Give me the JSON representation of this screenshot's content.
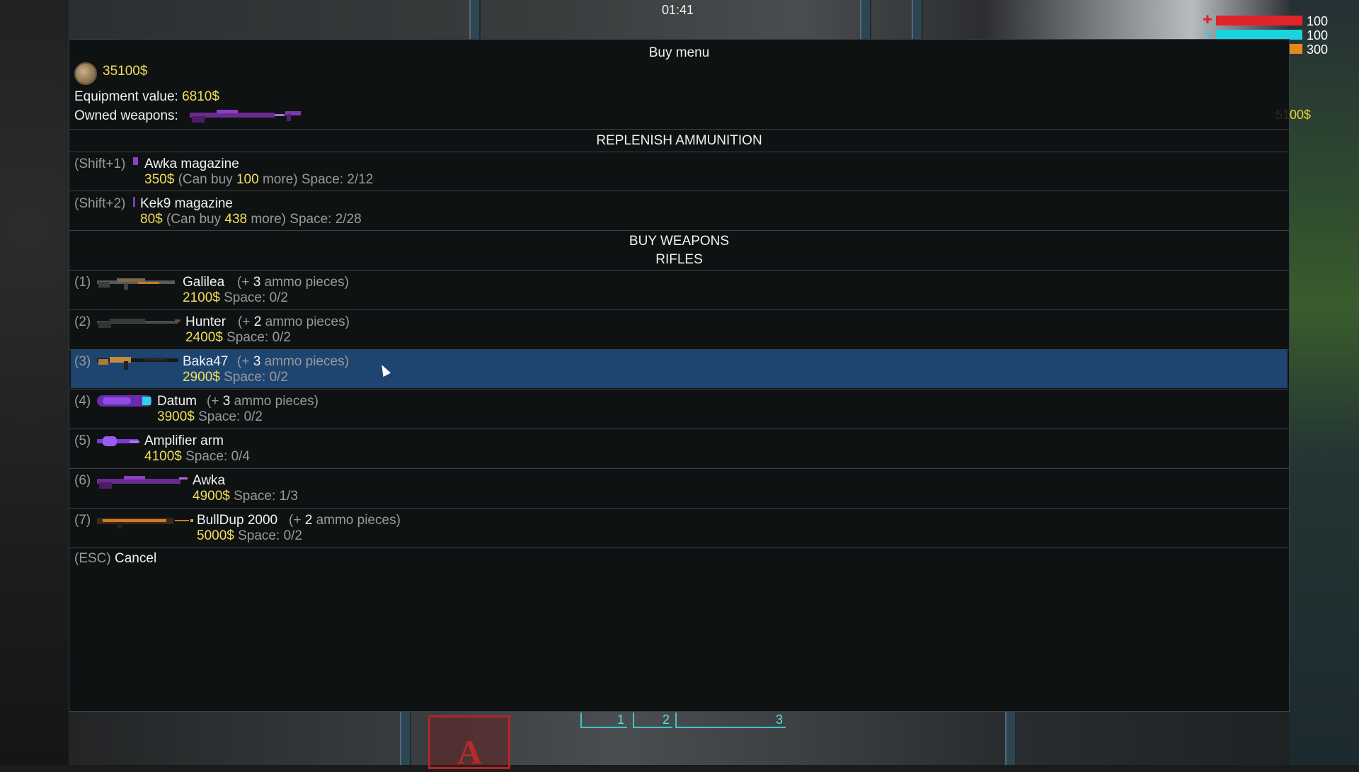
{
  "hud": {
    "clock": "01:41",
    "health": {
      "value": "100",
      "fraction": 1.0,
      "color": "#e0242a",
      "icon": "health-cross-icon"
    },
    "shield": {
      "value": "100",
      "fraction": 1.0,
      "color": "#19d4df",
      "icon": "energy-bolt-icon"
    },
    "ammo": {
      "value": "300",
      "fraction": 1.0,
      "color": "#e28a1c",
      "icon": "ammo-icon"
    },
    "money_partial": "5100$",
    "slots": [
      "1",
      "2",
      "3"
    ]
  },
  "menu": {
    "title": "Buy menu",
    "cash": "35100$",
    "equipment_value_label": "Equipment value:",
    "equipment_value": "6810$",
    "owned_weapons_label": "Owned weapons:",
    "replenish_title": "REPLENISH AMMUNITION",
    "buy_weapons_title": "BUY WEAPONS",
    "category_title": "RIFLES",
    "ammo": [
      {
        "key": "(Shift+1)",
        "name": "Awka magazine",
        "price": "350$",
        "can_buy_prefix": "(Can buy",
        "can_buy": "100",
        "can_buy_suffix": "more)",
        "space_label": "Space:",
        "space": "2/12",
        "icon": "awka-magazine-icon"
      },
      {
        "key": "(Shift+2)",
        "name": "Kek9 magazine",
        "price": "80$",
        "can_buy_prefix": "(Can buy",
        "can_buy": "438",
        "can_buy_suffix": "more)",
        "space_label": "Space:",
        "space": "2/28",
        "icon": "kek9-magazine-icon"
      }
    ],
    "weapons": [
      {
        "key": "(1)",
        "name": "Galilea",
        "ammo_prefix": "(+",
        "ammo_count": "3",
        "ammo_suffix": "ammo pieces)",
        "price": "2100$",
        "space_label": "Space:",
        "space": "0/2",
        "icon": "galilea-rifle-icon",
        "selected": false
      },
      {
        "key": "(2)",
        "name": "Hunter",
        "ammo_prefix": "(+",
        "ammo_count": "2",
        "ammo_suffix": "ammo pieces)",
        "price": "2400$",
        "space_label": "Space:",
        "space": "0/2",
        "icon": "hunter-rifle-icon",
        "selected": false
      },
      {
        "key": "(3)",
        "name": "Baka47",
        "ammo_prefix": "(+",
        "ammo_count": "3",
        "ammo_suffix": "ammo pieces)",
        "price": "2900$",
        "space_label": "Space:",
        "space": "0/2",
        "icon": "baka47-rifle-icon",
        "selected": true
      },
      {
        "key": "(4)",
        "name": "Datum",
        "ammo_prefix": "(+",
        "ammo_count": "3",
        "ammo_suffix": "ammo pieces)",
        "price": "3900$",
        "space_label": "Space:",
        "space": "0/2",
        "icon": "datum-rifle-icon",
        "selected": false
      },
      {
        "key": "(5)",
        "name": "Amplifier arm",
        "ammo_prefix": "",
        "ammo_count": "",
        "ammo_suffix": "",
        "price": "4100$",
        "space_label": "Space:",
        "space": "0/4",
        "icon": "amplifier-arm-icon",
        "selected": false
      },
      {
        "key": "(6)",
        "name": "Awka",
        "ammo_prefix": "",
        "ammo_count": "",
        "ammo_suffix": "",
        "price": "4900$",
        "space_label": "Space:",
        "space": "1/3",
        "icon": "awka-rifle-icon",
        "selected": false
      },
      {
        "key": "(7)",
        "name": "BullDup 2000",
        "ammo_prefix": "(+",
        "ammo_count": "2",
        "ammo_suffix": "ammo pieces)",
        "price": "5000$",
        "space_label": "Space:",
        "space": "0/2",
        "icon": "bulldup-rifle-icon",
        "selected": false
      }
    ],
    "cancel_key": "(ESC)",
    "cancel_label": "Cancel",
    "colors": {
      "selected_row": "#1e4470",
      "price": "#f2de5a",
      "muted": "#9a9a9a"
    }
  }
}
